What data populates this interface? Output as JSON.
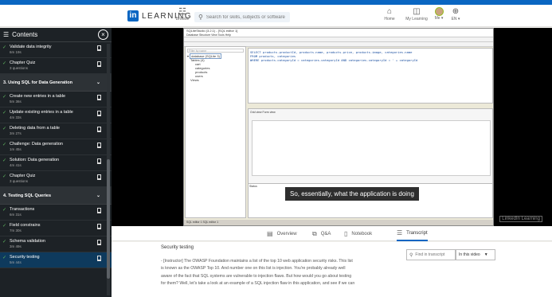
{
  "header": {
    "logo_letters": "in",
    "logo_text": "LEARNING",
    "browse_label": "Browse",
    "search_placeholder": "Search for skills, subjects or software",
    "nav": [
      {
        "label": "Home",
        "icon": "home-icon"
      },
      {
        "label": "My Learning",
        "icon": "book-icon"
      },
      {
        "label": "Me ▾",
        "icon": "avatar"
      },
      {
        "label": "EN ▾",
        "icon": "globe-icon"
      }
    ]
  },
  "sidebar": {
    "title": "Contents",
    "close_label": "×",
    "items": [
      {
        "type": "item",
        "title": "Validate data integrity",
        "duration": "6m 19s",
        "checked": true
      },
      {
        "type": "item",
        "title": "Chapter Quiz",
        "duration": "3 questions",
        "checked": true
      },
      {
        "type": "section",
        "title": "3. Using SQL for Data Generation"
      },
      {
        "type": "item",
        "title": "Create new entries in a table",
        "duration": "5m 36s",
        "checked": true
      },
      {
        "type": "item",
        "title": "Update existing entries in a table",
        "duration": "4m 33s",
        "checked": true
      },
      {
        "type": "item",
        "title": "Deleting data from a table",
        "duration": "3m 27s",
        "checked": true
      },
      {
        "type": "item",
        "title": "Challenge: Data generation",
        "duration": "1m 45s",
        "checked": true
      },
      {
        "type": "item",
        "title": "Solution: Data generation",
        "duration": "4m 41s",
        "checked": true
      },
      {
        "type": "item",
        "title": "Chapter Quiz",
        "duration": "3 questions",
        "checked": true
      },
      {
        "type": "section",
        "title": "4. Testing SQL Queries"
      },
      {
        "type": "item",
        "title": "Transactions",
        "duration": "6m 31s",
        "checked": true
      },
      {
        "type": "item",
        "title": "Field constrains",
        "duration": "7m 30s",
        "checked": true
      },
      {
        "type": "item",
        "title": "Schema validation",
        "duration": "3m 49s",
        "checked": true
      },
      {
        "type": "item",
        "title": "Security testing",
        "duration": "5m 44s",
        "checked": true,
        "active": true
      }
    ]
  },
  "video": {
    "window_title": "SQLiteStudio (3.2.1) - [SQL editor 1]",
    "menu": "Database  Structure  View  Tools  Help",
    "tree": {
      "filter": "Filter by name",
      "db": "database (SQLite 3)",
      "tables": "Tables (4)",
      "items": [
        "cart",
        "categories",
        "products",
        "users"
      ],
      "views": "Views"
    },
    "sql_lines": [
      "SELECT products.productId, products.name, products.price, products.image, categories.name",
      "FROM products, categories",
      "WHERE products.categoryId = categories.categoryId AND categories.categoryId = ' + categoryId"
    ],
    "results_tabs": "Grid view   Form view",
    "status_label": "Status",
    "bottom": "SQL editor 1   SQL editor 1",
    "caption": "So, essentially, what the application is doing",
    "watermark": "LinkedIn Learning"
  },
  "tabs": [
    {
      "label": "Overview",
      "icon": "overview-icon"
    },
    {
      "label": "Q&A",
      "icon": "qa-icon"
    },
    {
      "label": "Notebook",
      "icon": "notebook-icon"
    },
    {
      "label": "Transcript",
      "icon": "transcript-icon",
      "active": true
    }
  ],
  "transcript": {
    "title": "Security testing",
    "lines": [
      "- [Instructor] The OWASP Foundation maintains a list of the top 10 web application security risks. This list",
      "is known as the OWASP Top 10. And number one on this list is injection. You're probably already well",
      "aware of the fact that SQL systems are vulnerable to injection flaws. But how would you go about testing",
      "for them? Well, let's take a look at an example of a SQL injection flaw in this application, and see if we can"
    ],
    "search_placeholder": "Find in transcript",
    "scope": "In this video"
  }
}
